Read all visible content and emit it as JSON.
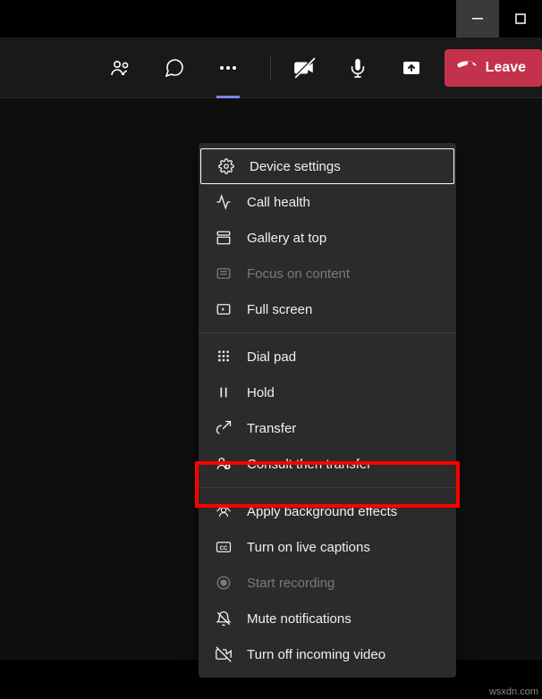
{
  "window": {
    "minimize": "minimize",
    "maximize": "maximize"
  },
  "toolbar": {
    "people": "people",
    "chat": "chat",
    "more": "more-actions",
    "camera": "camera-off",
    "mic": "microphone",
    "share": "share-screen",
    "leave_label": "Leave"
  },
  "menu": {
    "items": [
      {
        "label": "Device settings",
        "icon": "gear",
        "disabled": false,
        "section": 0
      },
      {
        "label": "Call health",
        "icon": "health",
        "disabled": false,
        "section": 0
      },
      {
        "label": "Gallery at top",
        "icon": "gallery",
        "disabled": false,
        "section": 0
      },
      {
        "label": "Focus on content",
        "icon": "focus",
        "disabled": true,
        "section": 0
      },
      {
        "label": "Full screen",
        "icon": "fullscreen",
        "disabled": false,
        "section": 0
      },
      {
        "label": "Dial pad",
        "icon": "dialpad",
        "disabled": false,
        "section": 1
      },
      {
        "label": "Hold",
        "icon": "hold",
        "disabled": false,
        "section": 1
      },
      {
        "label": "Transfer",
        "icon": "transfer",
        "disabled": false,
        "section": 1
      },
      {
        "label": "Consult then transfer",
        "icon": "consult",
        "disabled": false,
        "section": 1
      },
      {
        "label": "Apply background effects",
        "icon": "background",
        "disabled": false,
        "section": 2,
        "highlighted": true
      },
      {
        "label": "Turn on live captions",
        "icon": "cc",
        "disabled": false,
        "section": 2
      },
      {
        "label": "Start recording",
        "icon": "record",
        "disabled": true,
        "section": 2
      },
      {
        "label": "Mute notifications",
        "icon": "mute-notif",
        "disabled": false,
        "section": 2
      },
      {
        "label": "Turn off incoming video",
        "icon": "video-off",
        "disabled": false,
        "section": 2
      }
    ]
  },
  "watermark": "wsxdn.com"
}
